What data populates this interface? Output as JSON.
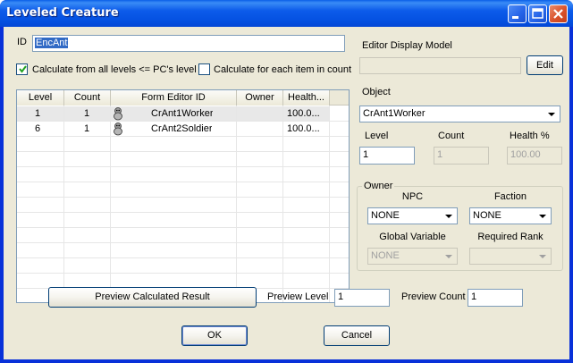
{
  "window": {
    "title": "Leveled Creature"
  },
  "id_field": {
    "label": "ID",
    "value": "EncAnt"
  },
  "options": {
    "calc_all_levels": {
      "label": "Calculate from all levels <= PC's level",
      "checked": true
    },
    "calc_each_item": {
      "label": "Calculate for each item in count",
      "checked": false
    }
  },
  "list": {
    "columns": [
      "Level",
      "Count",
      "Form Editor ID",
      "Owner",
      "Health..."
    ],
    "rows": [
      {
        "level": "1",
        "count": "1",
        "icon": "creature-icon",
        "form_id": "CrAnt1Worker",
        "owner": "",
        "health": "100.0..."
      },
      {
        "level": "6",
        "count": "1",
        "icon": "creature-icon",
        "form_id": "CrAnt2Soldier",
        "owner": "",
        "health": "100.0..."
      }
    ]
  },
  "editor_model": {
    "label": "Editor Display Model",
    "value": "",
    "edit_button": "Edit"
  },
  "object": {
    "label": "Object",
    "value": "CrAnt1Worker"
  },
  "level": {
    "label": "Level",
    "value": "1"
  },
  "count": {
    "label": "Count",
    "value": "1"
  },
  "health": {
    "label": "Health %",
    "value": "100.00"
  },
  "owner_group": {
    "title": "Owner",
    "npc_label": "NPC",
    "npc_value": "NONE",
    "faction_label": "Faction",
    "faction_value": "NONE",
    "global_label": "Global Variable",
    "global_value": "NONE",
    "rank_label": "Required Rank",
    "rank_value": ""
  },
  "preview": {
    "button": "Preview Calculated Result",
    "level_label": "Preview Level",
    "level_value": "1",
    "count_label": "Preview Count",
    "count_value": "1"
  },
  "buttons": {
    "ok": "OK",
    "cancel": "Cancel"
  },
  "colors": {
    "titlebar": "#0450e0",
    "face": "#ece9d8",
    "close": "#d9512a"
  }
}
